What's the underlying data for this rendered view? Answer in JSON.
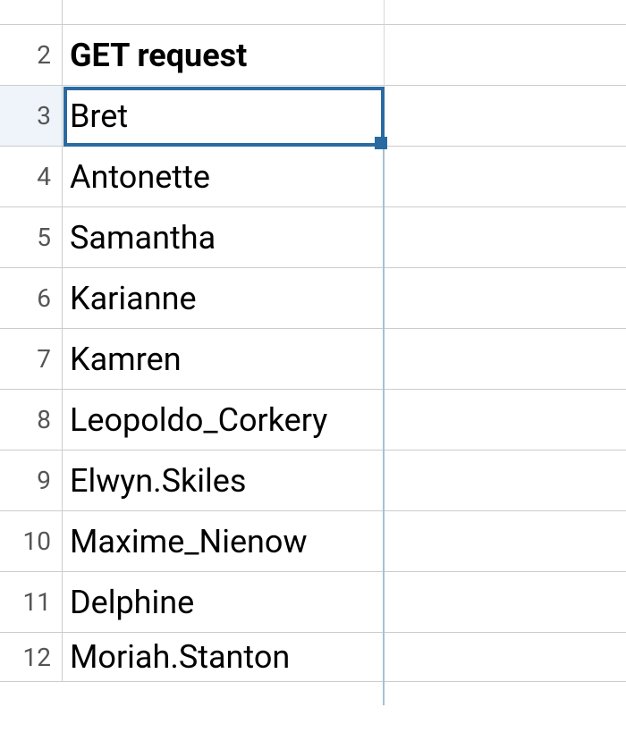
{
  "rows": [
    {
      "num": "",
      "value": ""
    },
    {
      "num": "2",
      "value": "GET request",
      "bold": true
    },
    {
      "num": "3",
      "value": "Bret",
      "active": true
    },
    {
      "num": "4",
      "value": "Antonette"
    },
    {
      "num": "5",
      "value": "Samantha"
    },
    {
      "num": "6",
      "value": "Karianne"
    },
    {
      "num": "7",
      "value": "Kamren"
    },
    {
      "num": "8",
      "value": "Leopoldo_Corkery"
    },
    {
      "num": "9",
      "value": "Elwyn.Skiles"
    },
    {
      "num": "10",
      "value": "Maxime_Nienow"
    },
    {
      "num": "11",
      "value": "Delphine"
    },
    {
      "num": "12",
      "value": "Moriah.Stanton"
    }
  ]
}
